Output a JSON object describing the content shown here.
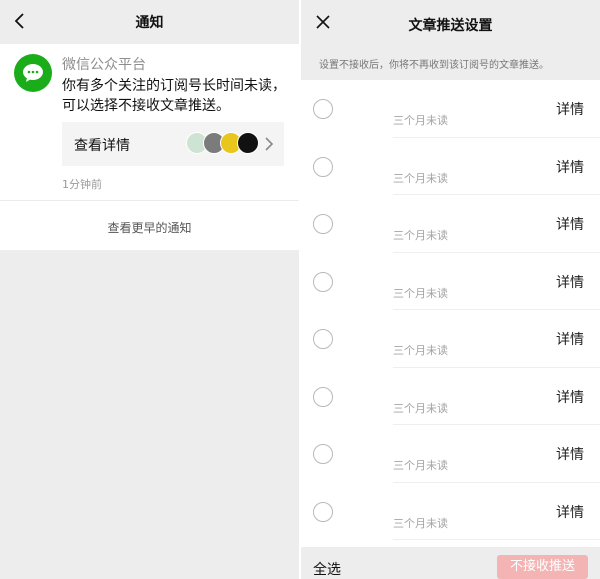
{
  "left": {
    "nav_title": "通知",
    "notification": {
      "sender": "微信公众平台",
      "message": "你有多个关注的订阅号长时间未读，可以选择不接收文章推送。",
      "detail_label": "查看详情",
      "time": "1分钟前",
      "badges": [
        {
          "label": "bg1",
          "color": "#cfe3d4"
        },
        {
          "label": "bg2",
          "color": "#7b7b7b"
        },
        {
          "label": "bg3",
          "color": "#e9c61c"
        },
        {
          "label": "bg4",
          "color": "#111111"
        }
      ]
    },
    "earlier_label": "查看更早的通知"
  },
  "right": {
    "nav_title": "文章推送设置",
    "tip": "设置不接收后，你将不再收到该订阅号的文章推送。",
    "rows": [
      {
        "status": "三个月未读",
        "action": "详情"
      },
      {
        "status": "三个月未读",
        "action": "详情"
      },
      {
        "status": "三个月未读",
        "action": "详情"
      },
      {
        "status": "三个月未读",
        "action": "详情"
      },
      {
        "status": "三个月未读",
        "action": "详情"
      },
      {
        "status": "三个月未读",
        "action": "详情"
      },
      {
        "status": "三个月未读",
        "action": "详情"
      },
      {
        "status": "三个月未读",
        "action": "详情"
      }
    ],
    "select_all": "全选",
    "reject_button": "不接收推送"
  },
  "colors": {
    "wechat_green": "#1aad19",
    "disabled_red": "#f4b4b4"
  }
}
